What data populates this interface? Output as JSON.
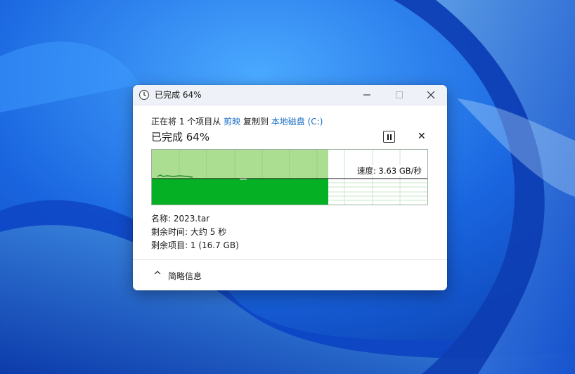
{
  "dialog": {
    "title": "已完成 64%",
    "line1": {
      "prefix": "正在将 1 个项目从",
      "source": "剪映",
      "middle": "复制到",
      "destination": "本地磁盘 (C:)"
    },
    "percent_text": "已完成 64%",
    "progress": 0.64,
    "speed_text": "速度: 3.63 GB/秒",
    "details": {
      "name_label": "名称:",
      "name_value": "2023.tar",
      "time_label": "剩余时间:",
      "time_value": "大约 5 秒",
      "items_label": "剩余项目:",
      "items_value": "1 (16.7 GB)"
    },
    "footer_label": "简略信息"
  },
  "icons": {
    "title": "clock-icon",
    "minimize": "minimize-icon",
    "maximize": "maximize-icon",
    "close": "close-icon",
    "pause": "pause-icon",
    "cancel": "cancel-icon",
    "footer": "chevron-up-icon"
  },
  "colors": {
    "progress_fill": "#06b025",
    "progress_light": "#acde92",
    "link": "#1a6fc4"
  }
}
